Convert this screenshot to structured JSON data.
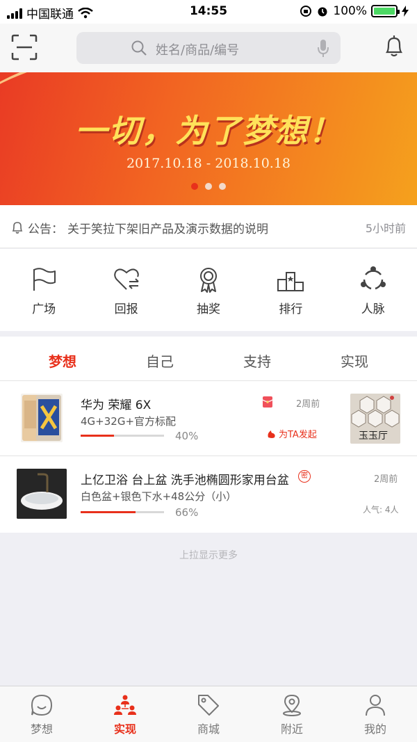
{
  "status_bar": {
    "carrier": "中国联通",
    "time": "14:55",
    "battery": "100%"
  },
  "header": {
    "search_placeholder": "姓名/商品/编号"
  },
  "banner": {
    "title": "一切，为了梦想！",
    "date_range": "2017.10.18 - 2018.10.18",
    "slides": 3,
    "active_slide": 1
  },
  "notice": {
    "label": "公告：",
    "text": "关于笑拉下架旧产品及演示数据的说明",
    "time": "5小时前"
  },
  "menu": [
    {
      "label": "广场",
      "icon": "flag-icon"
    },
    {
      "label": "回报",
      "icon": "heart-exchange-icon"
    },
    {
      "label": "抽奖",
      "icon": "award-ribbon-icon"
    },
    {
      "label": "排行",
      "icon": "podium-icon"
    },
    {
      "label": "人脉",
      "icon": "network-icon"
    }
  ],
  "tabs": [
    {
      "label": "梦想",
      "active": true
    },
    {
      "label": "自己",
      "active": false
    },
    {
      "label": "支持",
      "active": false
    },
    {
      "label": "实现",
      "active": false
    }
  ],
  "items": [
    {
      "title": "华为 荣耀 6X",
      "spec": "4G+32G+官方标配",
      "progress": 40,
      "percent": "40%",
      "time": "2周前",
      "action": "为TA发起",
      "shop_name": "玉玉厅",
      "badge_icon": "red-packet-icon"
    },
    {
      "title": "上亿卫浴 台上盆 洗手池椭圆形家用台盆",
      "spec": "白色盆+银色下水+48公分（小）",
      "progress": 66,
      "percent": "66%",
      "time": "2周前",
      "popularity": "人气: 4人",
      "badge_icon": "secret-icon",
      "badge_text": "密"
    }
  ],
  "load_more": "上拉显示更多",
  "tabbar": [
    {
      "label": "梦想",
      "icon": "smile-icon",
      "active": false
    },
    {
      "label": "实现",
      "icon": "team-icon",
      "active": true
    },
    {
      "label": "商城",
      "icon": "tag-icon",
      "active": false
    },
    {
      "label": "附近",
      "icon": "location-icon",
      "active": false
    },
    {
      "label": "我的",
      "icon": "user-icon",
      "active": false
    }
  ],
  "colors": {
    "accent": "#e8301b",
    "battery": "#4cd964",
    "banner_start": "#e93b24",
    "banner_end": "#f5a11d"
  }
}
